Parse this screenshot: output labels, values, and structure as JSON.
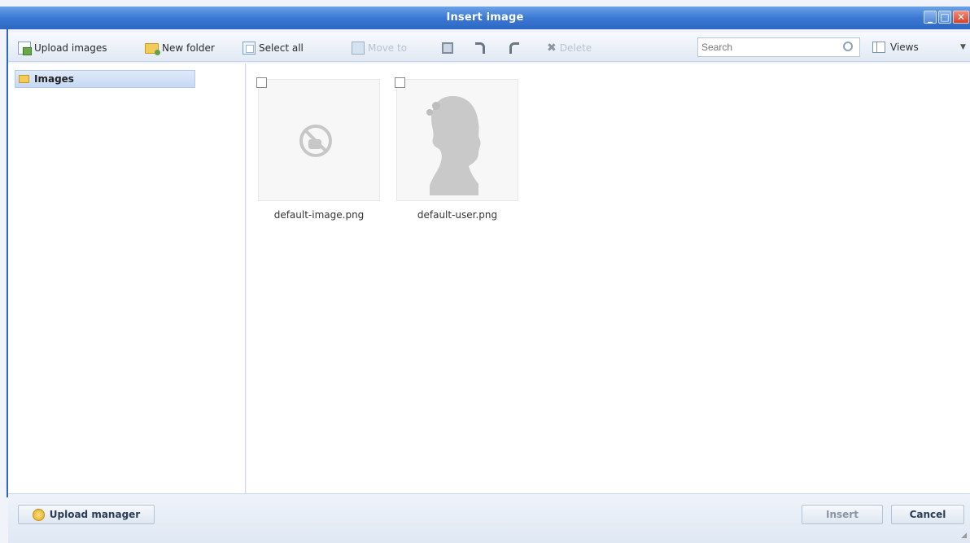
{
  "window": {
    "title": "Insert image"
  },
  "toolbar": {
    "upload_images": "Upload images",
    "new_folder": "New folder",
    "select_all": "Select all",
    "move_to": "Move to",
    "delete": "Delete",
    "search_placeholder": "Search",
    "views": "Views"
  },
  "tree": {
    "items": [
      {
        "label": "Images"
      }
    ]
  },
  "files": [
    {
      "name": "default-image.png"
    },
    {
      "name": "default-user.png"
    }
  ],
  "footer": {
    "upload_manager": "Upload manager",
    "insert": "Insert",
    "cancel": "Cancel"
  },
  "colors": {
    "titlebar": "#3b78d4",
    "accent_border": "#2e67c2"
  }
}
